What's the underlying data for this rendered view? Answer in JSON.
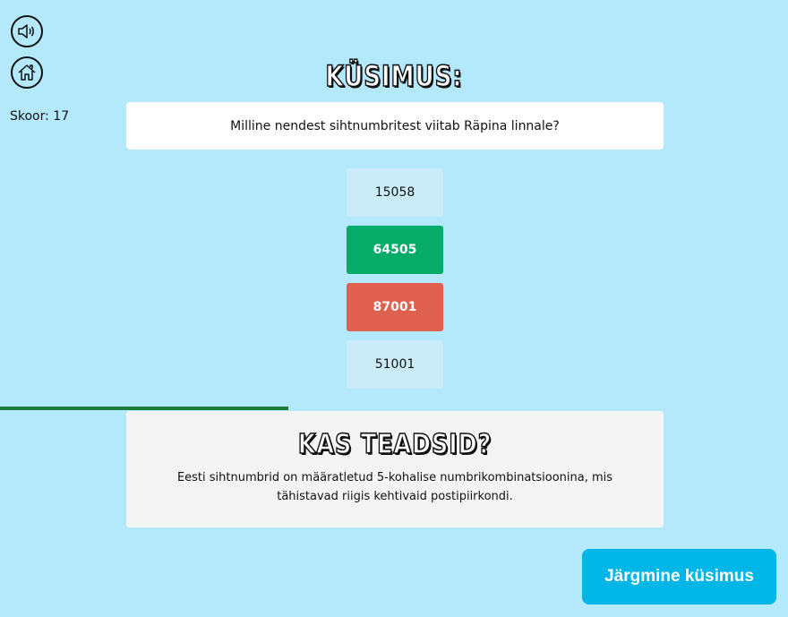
{
  "header": {
    "sound_icon": "speaker-icon",
    "home_icon": "home-icon",
    "score_label": "Skoor: 17"
  },
  "quiz": {
    "title": "KÜSIMUS:",
    "question": "Milline nendest sihtnumbritest viitab Räpina linnale?",
    "answers": [
      {
        "label": "15058",
        "state": "neutral"
      },
      {
        "label": "64505",
        "state": "correct"
      },
      {
        "label": "87001",
        "state": "wrong"
      },
      {
        "label": "51001",
        "state": "neutral"
      }
    ],
    "progress": 0.366
  },
  "info": {
    "title": "KAS TEADSID?",
    "text": "Eesti sihtnumbrid on määratletud 5-kohalise numbrikombinatsioonina, mis tähistavad riigis kehtivaid postipiirkondi."
  },
  "next_button": "Järgmine küsimus",
  "colors": {
    "background": "#b3e9fa",
    "correct": "#06ab6a",
    "wrong": "#e06050",
    "neutral": "#c9ecf8",
    "next_button": "#00b6e6",
    "progress": "#1a7a3a"
  }
}
